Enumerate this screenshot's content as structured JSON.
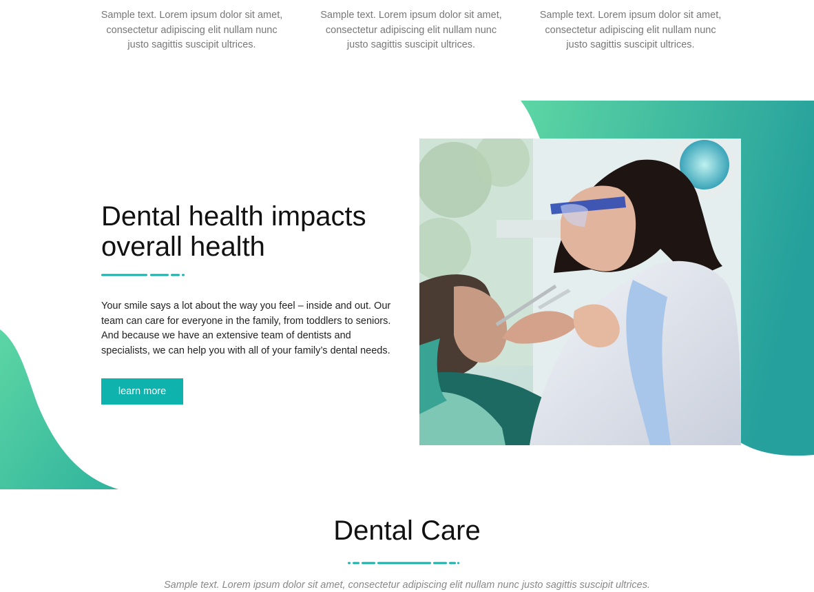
{
  "top_features": [
    {
      "text": "Sample text. Lorem ipsum dolor sit amet, consectetur adipiscing elit nullam nunc justo sagittis suscipit ultrices."
    },
    {
      "text": "Sample text. Lorem ipsum dolor sit amet, consectetur adipiscing elit nullam nunc justo sagittis suscipit ultrices."
    },
    {
      "text": "Sample text. Lorem ipsum dolor sit amet, consectetur adipiscing elit nullam nunc justo sagittis suscipit ultrices."
    }
  ],
  "hero": {
    "title": "Dental health impacts overall health",
    "body": "Your smile says a lot about the way you feel – inside and out. Our team can care for everyone in the family, from toddlers to seniors. And because we have an extensive team of dentists and specialists, we can help you with all of your family’s dental needs.",
    "button_label": "learn more"
  },
  "section": {
    "title": "Dental Care",
    "subtitle": "Sample text. Lorem ipsum dolor sit amet, consectetur adipiscing elit nullam nunc justo sagittis suscipit ultrices."
  },
  "colors": {
    "accent": "#0fb3ad",
    "gradient_start": "#5dd6a4",
    "gradient_end": "#25a09c",
    "heading": "#111111",
    "muted_text": "#777777"
  },
  "icons": {
    "photo": "dentist-with-patient-photo"
  }
}
